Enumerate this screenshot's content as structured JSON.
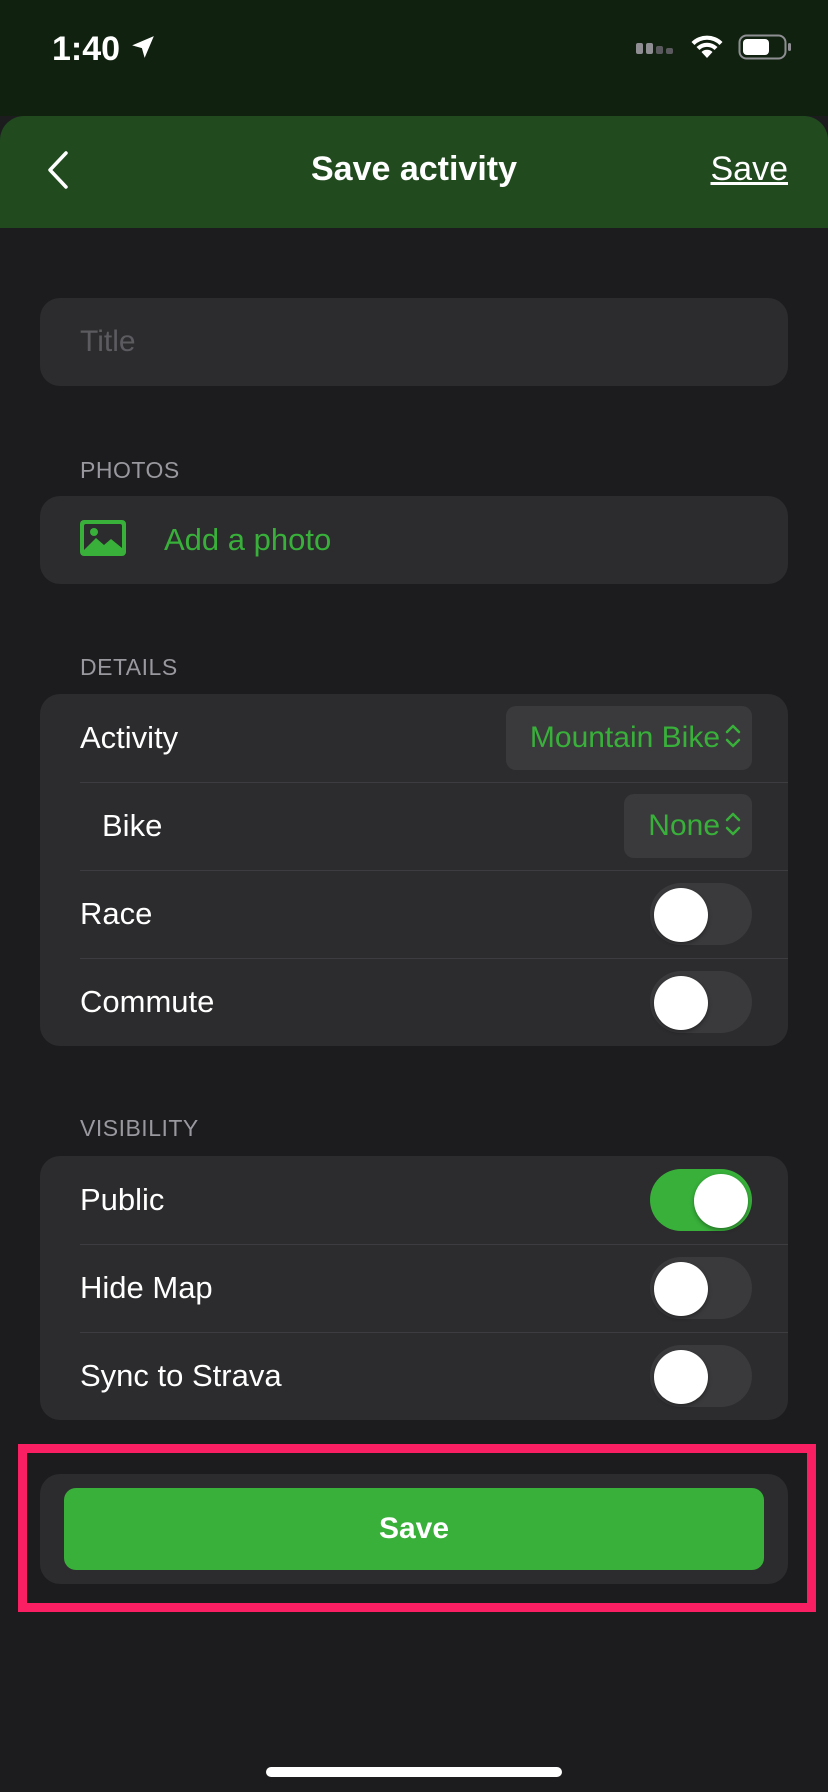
{
  "status_bar": {
    "time": "1:40",
    "location_icon": "location-arrow-icon",
    "signal_icon": "cellular-signal-icon",
    "wifi_icon": "wifi-icon",
    "battery_icon": "battery-icon"
  },
  "nav": {
    "back_icon": "chevron-left-icon",
    "title": "Save activity",
    "save_label": "Save"
  },
  "title_field": {
    "placeholder": "Title",
    "value": ""
  },
  "photos": {
    "header": "PHOTOS",
    "icon": "photo-icon",
    "add_label": "Add a photo"
  },
  "details": {
    "header": "DETAILS",
    "activity": {
      "label": "Activity",
      "value": "Mountain Bike"
    },
    "bike": {
      "label": "Bike",
      "value": "None"
    },
    "race": {
      "label": "Race",
      "on": false
    },
    "commute": {
      "label": "Commute",
      "on": false
    }
  },
  "visibility": {
    "header": "VISIBILITY",
    "public": {
      "label": "Public",
      "on": true
    },
    "hide_map": {
      "label": "Hide Map",
      "on": false
    },
    "sync_strava": {
      "label": "Sync to Strava",
      "on": false
    }
  },
  "save_button": {
    "label": "Save"
  },
  "colors": {
    "accent": "#38b03a",
    "nav_background": "#214a1f",
    "status_background": "#10210f",
    "page_background": "#1c1c1e",
    "card_background": "#2c2c2e",
    "highlight": "#fa1e62"
  }
}
